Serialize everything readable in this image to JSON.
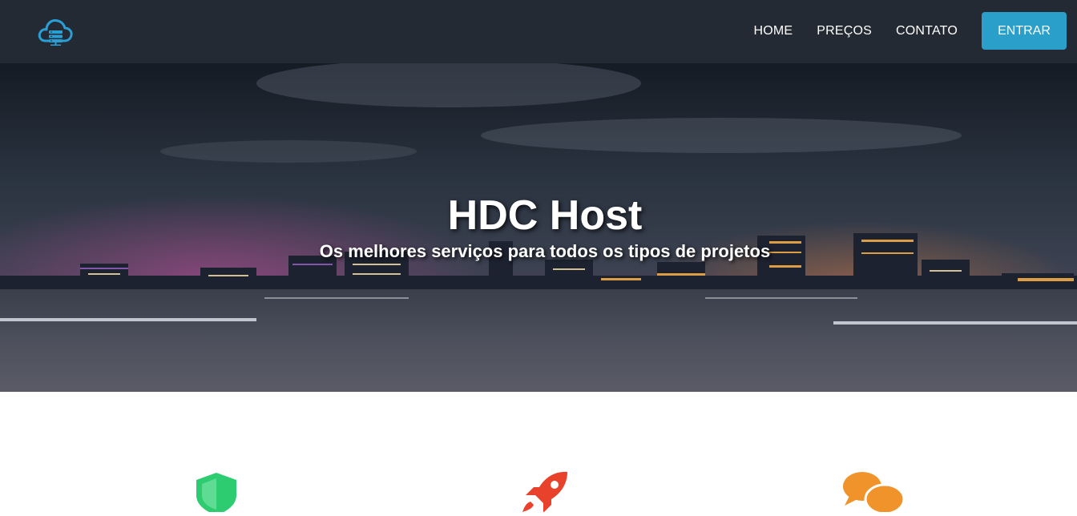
{
  "nav": {
    "logo_icon": "cloud-server-icon",
    "links": [
      {
        "label": "HOME"
      },
      {
        "label": "PREÇOS"
      },
      {
        "label": "CONTATO"
      }
    ],
    "cta_label": "ENTRAR"
  },
  "hero": {
    "title": "HDC Host",
    "subtitle": "Os melhores serviços para todos os tipos de projetos"
  },
  "features": {
    "icons": [
      "shield-icon",
      "rocket-icon",
      "chat-bubbles-icon"
    ]
  },
  "colors": {
    "navbar": "#232a33",
    "accent": "#2a9fc9",
    "shield": "#2ecc71",
    "rocket": "#e8422c",
    "chat": "#f0932b"
  }
}
